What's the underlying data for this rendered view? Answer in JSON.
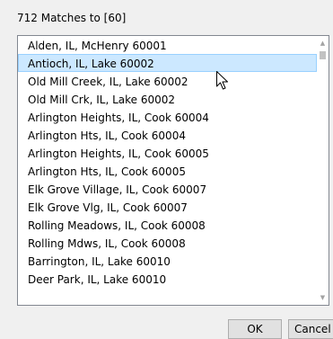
{
  "dialog": {
    "header": "712 Matches to [60]",
    "ok_label": "OK",
    "cancel_label": "Cancel"
  },
  "list": {
    "selected_index": 1,
    "items": [
      "Alden, IL, McHenry 60001",
      "Antioch, IL, Lake 60002",
      "Old Mill Creek, IL, Lake 60002",
      "Old Mill Crk, IL, Lake 60002",
      "Arlington Heights, IL, Cook 60004",
      "Arlington Hts, IL, Cook 60004",
      "Arlington Heights, IL, Cook 60005",
      "Arlington Hts, IL, Cook 60005",
      "Elk Grove Village, IL, Cook 60007",
      "Elk Grove Vlg, IL, Cook 60007",
      "Rolling Meadows, IL, Cook 60008",
      "Rolling Mdws, IL, Cook 60008",
      "Barrington, IL, Lake 60010",
      "Deer Park, IL, Lake 60010"
    ]
  },
  "icons": {
    "scroll_up": "scroll-up-arrow-icon",
    "scroll_down": "scroll-down-arrow-icon",
    "pointer": "mouse-pointer-icon"
  },
  "colors": {
    "selection_fill": "#cce8ff",
    "selection_border": "#99d1ff",
    "dialog_background": "#f0f0f0"
  }
}
